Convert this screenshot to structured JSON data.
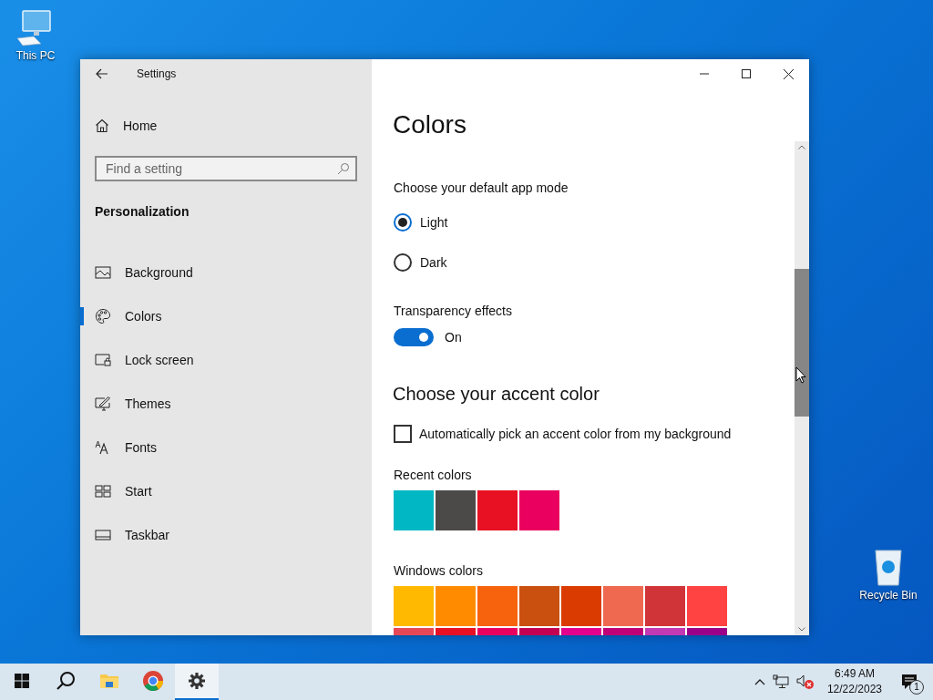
{
  "desktop_icons": [
    {
      "kind": "computer",
      "label": "This PC"
    },
    {
      "kind": "recycle",
      "label": "Recycle Bin"
    }
  ],
  "window": {
    "title": "Settings"
  },
  "sidebar": {
    "home": "Home",
    "search": {
      "placeholder": "Find a setting"
    },
    "section": "Personalization",
    "items": [
      {
        "kind": "background",
        "label": "Background",
        "selected": false
      },
      {
        "kind": "colors",
        "label": "Colors",
        "selected": true
      },
      {
        "kind": "lock",
        "label": "Lock screen",
        "selected": false
      },
      {
        "kind": "themes",
        "label": "Themes",
        "selected": false
      },
      {
        "kind": "fonts",
        "label": "Fonts",
        "selected": false
      },
      {
        "kind": "start",
        "label": "Start",
        "selected": false
      },
      {
        "kind": "taskbar",
        "label": "Taskbar",
        "selected": false
      }
    ]
  },
  "content": {
    "heading": "Colors",
    "app_mode": {
      "label": "Choose your default app mode",
      "options": [
        {
          "label": "Light",
          "selected": true
        },
        {
          "label": "Dark",
          "selected": false
        }
      ]
    },
    "transparency": {
      "label": "Transparency effects",
      "on": true,
      "state_label": "On"
    },
    "accent_heading": "Choose your accent color",
    "auto_pick": {
      "label": "Automatically pick an accent color from my background",
      "checked": false
    },
    "recent_colors": {
      "label": "Recent colors",
      "swatches": [
        {
          "color": "#00b7c3"
        },
        {
          "color": "#4c4a48"
        },
        {
          "color": "#e81123"
        },
        {
          "color": "#ea005e"
        }
      ]
    },
    "windows_colors": {
      "label": "Windows colors",
      "swatches": [
        {
          "color": "#ffb900"
        },
        {
          "color": "#ff8c00"
        },
        {
          "color": "#f7630c"
        },
        {
          "color": "#ca5010"
        },
        {
          "color": "#da3b01"
        },
        {
          "color": "#ef6950"
        },
        {
          "color": "#d13438"
        },
        {
          "color": "#ff4343"
        },
        {
          "color": "#e74856"
        },
        {
          "color": "#e81123"
        },
        {
          "color": "#ea005e"
        },
        {
          "color": "#c30052"
        },
        {
          "color": "#e3008c"
        },
        {
          "color": "#bf0077"
        },
        {
          "color": "#c239b3"
        },
        {
          "color": "#9a0089"
        }
      ]
    }
  },
  "taskbar": {
    "apps": [
      {
        "kind": "start",
        "selected": false
      },
      {
        "kind": "search",
        "selected": false
      },
      {
        "kind": "explorer",
        "selected": false
      },
      {
        "kind": "browser",
        "selected": false
      },
      {
        "kind": "settings",
        "selected": true
      }
    ],
    "time": "6:49 AM",
    "date": "12/22/2023",
    "notification_count": "1"
  }
}
